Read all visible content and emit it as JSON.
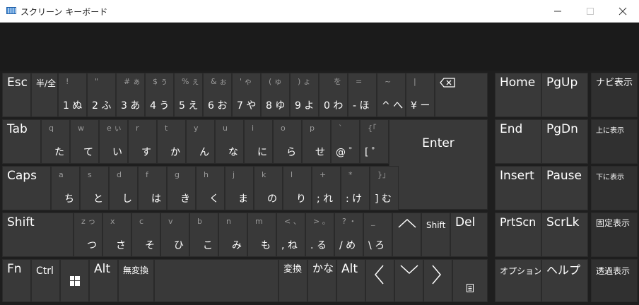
{
  "window": {
    "title": "スクリーン キーボード",
    "icons": [
      "keyboard-app-icon",
      "minimize-icon",
      "maximize-icon",
      "close-icon"
    ]
  },
  "colors": {
    "key": "#393939",
    "background": "#1e1e1e",
    "titlebar": "#ffffff",
    "text": "#ffffff",
    "shift_text": "#9a9a9a"
  },
  "keys": {
    "esc": "Esc",
    "hankaku": "半/全",
    "d1_s": "!",
    "d1": "1 ぬ",
    "d2_s": "\"",
    "d2": "2 ふ",
    "d3_s": "# ぁ",
    "d3": "3 あ",
    "d4_s": "$ ぅ",
    "d4": "4 う",
    "d5_s": "% ぇ",
    "d5": "5 え",
    "d6_s": "& ぉ",
    "d6": "6 お",
    "d7_s": "' ゃ",
    "d7": "7 や",
    "d8_s": "( ゅ",
    "d8": "8 ゆ",
    "d9_s": ") ょ",
    "d9": "9 よ",
    "d0_s": "を",
    "d0": "0 わ",
    "minus_s": "=",
    "minus": "- ほ",
    "caret_s": "~",
    "caret": "^ へ",
    "yen_s": "|",
    "yen": "¥ ー",
    "tab": "Tab",
    "q_s": "q",
    "q": "た",
    "w_s": "w",
    "w": "て",
    "e_s": "e ぃ",
    "e": "い",
    "r_s": "r",
    "r": "す",
    "t_s": "t",
    "t": "か",
    "y_s": "y",
    "y": "ん",
    "u_s": "u",
    "u": "な",
    "i_s": "i",
    "i": "に",
    "o_s": "o",
    "o": "ら",
    "p_s": "p",
    "p": "せ",
    "at_s": "`",
    "at": "@ ゛",
    "lb_s": "{「",
    "lb": "[ ゜",
    "enter": "Enter",
    "caps": "Caps",
    "a_s": "a",
    "a": "ち",
    "s_s": "s",
    "s": "と",
    "d_s": "d",
    "d": "し",
    "f_s": "f",
    "f": "は",
    "g_s": "g",
    "g": "き",
    "h_s": "h",
    "h": "く",
    "j_s": "j",
    "j": "ま",
    "k_s": "k",
    "k": "の",
    "l_s": "l",
    "l": "り",
    "semi_s": "+",
    "semi": "; れ",
    "colon_s": "*",
    "colon": ": け",
    "rb_s": "}」",
    "rb": "] む",
    "shift": "Shift",
    "z_s": "z っ",
    "z": "つ",
    "x_s": "x",
    "x": "さ",
    "c_s": "c",
    "c": "そ",
    "v_s": "v",
    "v": "ひ",
    "b_s": "b",
    "b": "こ",
    "n_s": "n",
    "n": "み",
    "m_s": "m",
    "m": "も",
    "comma_s": "< 、",
    "comma": ", ね",
    "period_s": "> 。",
    "period": ". る",
    "slash_s": "? ・",
    "slash": "/ め",
    "ro_s": "_",
    "ro": "\\ ろ",
    "rshift": "Shift",
    "del": "Del",
    "fn": "Fn",
    "ctrl": "Ctrl",
    "alt": "Alt",
    "muhenkan": "無変換",
    "henkan": "変換",
    "kana": "かな",
    "ralt": "Alt",
    "home": "Home",
    "pgup": "PgUp",
    "navi": "ナビ表示",
    "end": "End",
    "pgdn": "PgDn",
    "up_disp": "上に表示",
    "insert": "Insert",
    "pause": "Pause",
    "down_disp": "下に表示",
    "prtscn": "PrtScn",
    "scrlk": "ScrLk",
    "fix_disp": "固定表示",
    "options": "オプション",
    "help": "ヘルプ",
    "trans_disp": "透過表示"
  }
}
